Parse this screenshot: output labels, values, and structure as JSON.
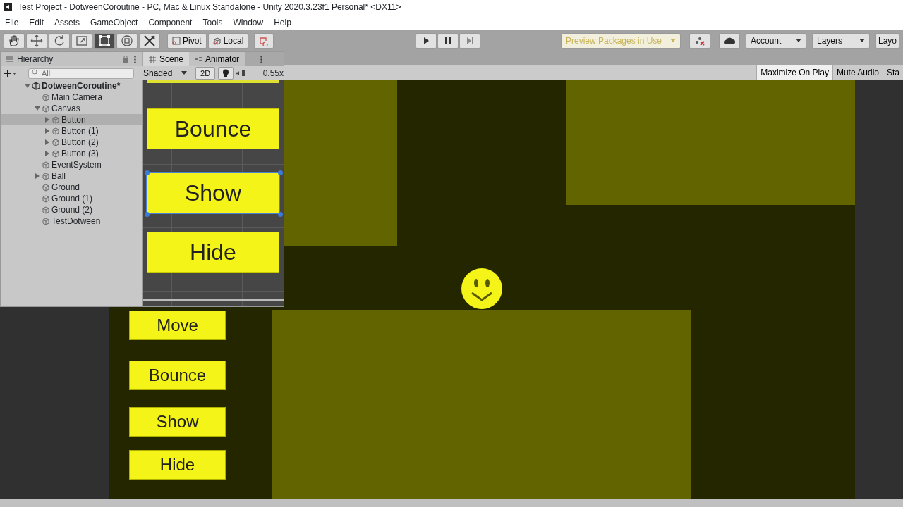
{
  "window": {
    "title": "Test Project - DotweenCoroutine - PC, Mac & Linux Standalone - Unity 2020.3.23f1 Personal* <DX11>"
  },
  "menu": [
    "File",
    "Edit",
    "Assets",
    "GameObject",
    "Component",
    "Tools",
    "Window",
    "Help"
  ],
  "toolbar": {
    "tools": [
      {
        "kind": "hand",
        "selected": false
      },
      {
        "kind": "move",
        "selected": false
      },
      {
        "kind": "rotate",
        "selected": false
      },
      {
        "kind": "scale",
        "selected": false
      },
      {
        "kind": "rect",
        "selected": true
      },
      {
        "kind": "transform",
        "selected": false
      },
      {
        "kind": "custom",
        "selected": false
      }
    ],
    "pivot": "Pivot",
    "local": "Local",
    "preview_packages": "Preview Packages in Use",
    "account": "Account",
    "layers": "Layers",
    "layout": "Layo"
  },
  "game_toolbar": [
    {
      "label": "Maximize On Play",
      "selected": true
    },
    {
      "label": "Mute Audio",
      "selected": false
    },
    {
      "label": "Sta",
      "selected": false
    }
  ],
  "hierarchy": {
    "title": "Hierarchy",
    "search_placeholder": "All",
    "tree": [
      {
        "name": "DotweenCoroutine*",
        "kind": "scene",
        "expanded": true,
        "selected": false,
        "children": [
          {
            "name": "Main Camera",
            "selected": false
          },
          {
            "name": "Canvas",
            "expanded": true,
            "selected": false,
            "children": [
              {
                "name": "Button",
                "expanded": false,
                "selected": true
              },
              {
                "name": "Button (1)",
                "expanded": false,
                "selected": false
              },
              {
                "name": "Button (2)",
                "expanded": false,
                "selected": false
              },
              {
                "name": "Button (3)",
                "expanded": false,
                "selected": false
              }
            ]
          },
          {
            "name": "EventSystem",
            "selected": false
          },
          {
            "name": "Ball",
            "expanded": false,
            "selected": false
          },
          {
            "name": "Ground",
            "selected": false
          },
          {
            "name": "Ground (1)",
            "selected": false
          },
          {
            "name": "Ground (2)",
            "selected": false
          },
          {
            "name": "TestDotween",
            "selected": false
          }
        ]
      }
    ]
  },
  "scene_view": {
    "tabs": [
      {
        "label": "Scene",
        "selected": true
      },
      {
        "label": "Animator",
        "selected": false
      }
    ],
    "shading": "Shaded",
    "mode_2d": "2D",
    "zoom": "0.55x",
    "zoom_slider": {
      "level": 0
    },
    "buttons": [
      {
        "label": "Bounce",
        "selected": false
      },
      {
        "label": "Show",
        "selected": true
      },
      {
        "label": "Hide",
        "selected": false
      }
    ]
  },
  "game_view": {
    "buttons": [
      "Move",
      "Bounce",
      "Show",
      "Hide"
    ]
  }
}
